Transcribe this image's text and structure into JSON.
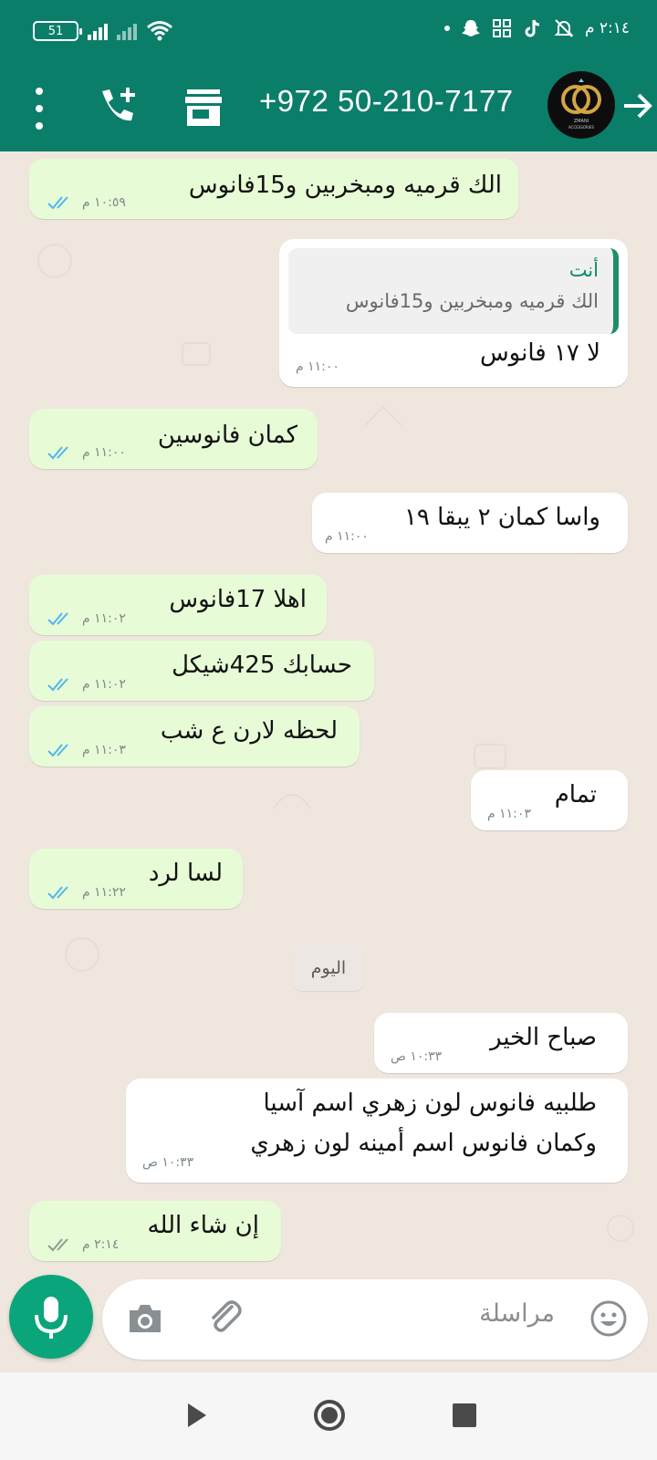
{
  "status_bar": {
    "battery": "51",
    "time": "٢:١٤ م"
  },
  "header": {
    "contact_name": "+972 50-210-7177",
    "avatar_text": "ZMANI ACCESSORIES"
  },
  "messages": [
    {
      "text": "الك قرميه ومبخربين و15فانوس",
      "time": "١٠:٥٩ م",
      "direction": "out",
      "status": "read"
    },
    {
      "quote_author": "أنت",
      "quote_text": "الك قرميه ومبخربين و15فانوس",
      "text": "لا ١٧ فانوس",
      "time": "١١:٠٠ م",
      "direction": "in"
    },
    {
      "text": "كمان فانوسين",
      "time": "١١:٠٠ م",
      "direction": "out",
      "status": "read"
    },
    {
      "text": "واسا كمان ٢ يبقا ١٩",
      "time": "١١:٠٠ م",
      "direction": "in"
    },
    {
      "text": "اهلا 17فانوس",
      "time": "١١:٠٢ م",
      "direction": "out",
      "status": "read"
    },
    {
      "text": "حسابك 425شيكل",
      "time": "١١:٠٢ م",
      "direction": "out",
      "status": "read"
    },
    {
      "text": "لحظه لارن ع شب",
      "time": "١١:٠٣ م",
      "direction": "out",
      "status": "read"
    },
    {
      "text": "تمام",
      "time": "١١:٠٣ م",
      "direction": "in"
    },
    {
      "text": "لسا لرد",
      "time": "١١:٢٢ م",
      "direction": "out",
      "status": "read"
    },
    {
      "text": "صباح الخير",
      "time": "١٠:٣٣ ص",
      "direction": "in"
    },
    {
      "text_line1": "طلبيه فانوس لون زهري اسم آسيا",
      "text_line2": "وكمان فانوس اسم أمينه لون زهري",
      "time": "١٠:٣٣ ص",
      "direction": "in"
    },
    {
      "text": "إن شاء الله",
      "time": "٢:١٤ م",
      "direction": "out",
      "status": "delivered"
    }
  ],
  "date_divider": "اليوم",
  "composer": {
    "placeholder": "مراسلة"
  },
  "colors": {
    "header_bg": "#0b7e6a",
    "chat_bg": "#efe7de",
    "outgoing_bubble": "#e7fcd6",
    "incoming_bubble": "#ffffff",
    "mic_button": "#0aa57a",
    "read_tick": "#4fb6ec"
  },
  "icons": {
    "status_bar": [
      "battery-icon",
      "signal-icon",
      "wifi-icon",
      "snapchat-icon",
      "app-grid-icon",
      "tiktok-icon",
      "alarm-off-icon"
    ],
    "header": [
      "more-options-icon",
      "add-call-icon",
      "store-icon",
      "back-arrow-icon"
    ],
    "composer": [
      "mic-icon",
      "camera-icon",
      "attach-icon",
      "emoji-icon"
    ],
    "navigation": [
      "back-nav-icon",
      "home-nav-icon",
      "recents-nav-icon"
    ]
  }
}
